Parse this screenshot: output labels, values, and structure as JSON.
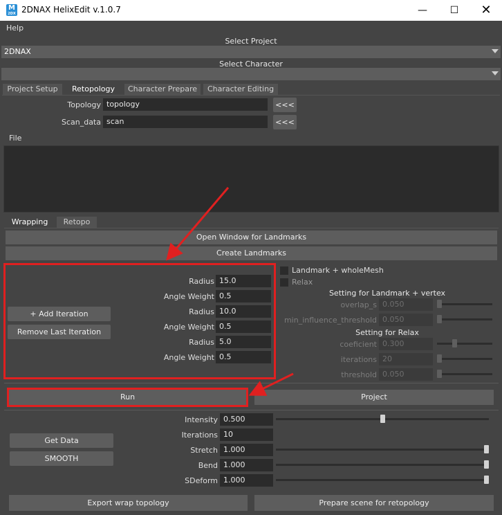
{
  "window": {
    "title": "2DNAX HelixEdit v.1.0.7",
    "icon_letter": "M",
    "icon_sub": "2DX"
  },
  "menu": {
    "help": "Help"
  },
  "project": {
    "label": "Select Project",
    "value": "2DNAX"
  },
  "character": {
    "label": "Select Character",
    "value": ""
  },
  "main_tabs": [
    {
      "label": "Project Setup",
      "active": false
    },
    {
      "label": "Retopology",
      "active": true
    },
    {
      "label": "Character Prepare",
      "active": false
    },
    {
      "label": "Character Editing",
      "active": false
    }
  ],
  "retopo": {
    "topology_label": "Topology",
    "topology_value": "topology",
    "scan_label": "Scan_data",
    "scan_value": "scan",
    "pick_label": "<<<",
    "file_label": "File"
  },
  "sub_tabs": [
    {
      "label": "Wrapping",
      "active": true
    },
    {
      "label": "Retopo",
      "active": false
    }
  ],
  "wrapping": {
    "open_landmarks": "Open Window for Landmarks",
    "create_landmarks": "Create Landmarks",
    "add_iteration": "+ Add Iteration",
    "remove_iteration": "Remove Last Iteration",
    "iterations": [
      {
        "radius_label": "Radius",
        "radius": "15.0",
        "angle_label": "Angle Weight",
        "angle": "0.5"
      },
      {
        "radius_label": "Radius",
        "radius": "10.0",
        "angle_label": "Angle Weight",
        "angle": "0.5"
      },
      {
        "radius_label": "Radius",
        "radius": "5.0",
        "angle_label": "Angle Weight",
        "angle": "0.5"
      }
    ],
    "landmark_whole_mesh": "Landmark + wholeMesh",
    "relax": "Relax",
    "setting_landmark_vertex": "Setting for Landmark + vertex",
    "overlap_label": "overlap_s",
    "overlap_value": "0.050",
    "overlap_level": 0.0,
    "min_influence_label": "min_influence_threshold",
    "min_influence_value": "0.050",
    "min_influence_level": 0.0,
    "setting_relax": "Setting for Relax",
    "coef_label": "coeficient",
    "coef_value": "0.300",
    "coef_level": 0.3,
    "iter_label": "iterations",
    "iter_value": "20",
    "iter_level": 0.0,
    "thresh_label": "threshold",
    "thresh_value": "0.050",
    "thresh_level": 0.0,
    "run": "Run",
    "project": "Project"
  },
  "deform": {
    "get_data": "Get Data",
    "smooth": "SMOOTH",
    "intensity_label": "Intensity",
    "intensity_value": "0.500",
    "intensity_level": 0.5,
    "iterations_label": "Iterations",
    "iterations_value": "10",
    "stretch_label": "Stretch",
    "stretch_value": "1.000",
    "stretch_level": 1.0,
    "bend_label": "Bend",
    "bend_value": "1.000",
    "bend_level": 1.0,
    "sdeform_label": "SDeform",
    "sdeform_value": "1.000",
    "sdeform_level": 1.0
  },
  "bottom": {
    "export_wrap": "Export wrap topology",
    "prepare_scene": "Prepare scene for retopology"
  },
  "colors": {
    "annotation_red": "#e02020",
    "background": "#444444",
    "field": "#2b2b2b"
  }
}
